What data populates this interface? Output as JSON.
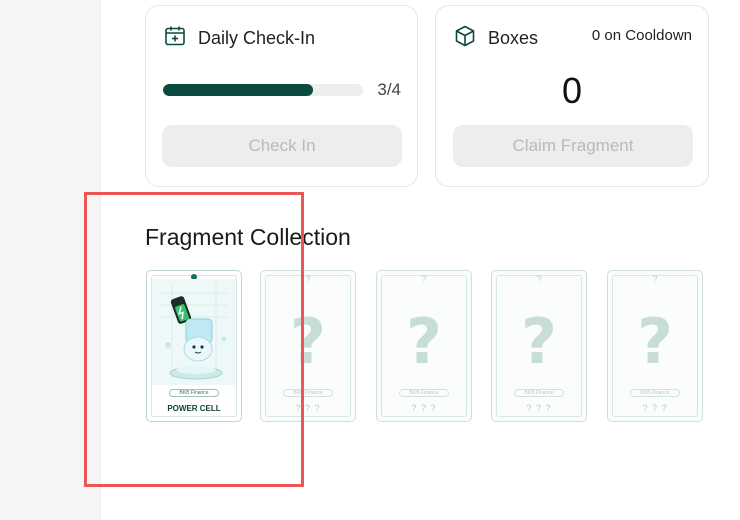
{
  "checkin": {
    "title": "Daily Check-In",
    "progress_text": "3/4",
    "progress_fraction": 0.75,
    "button_label": "Check In"
  },
  "boxes": {
    "title": "Boxes",
    "cooldown_text": "0 on Cooldown",
    "count": "0",
    "button_label": "Claim Fragment"
  },
  "collection": {
    "title": "Fragment Collection",
    "fragments": [
      {
        "name": "POWER CELL",
        "brand": "BKB Finance",
        "unlocked": true
      },
      {
        "top": "?",
        "mark": "?",
        "brand": "BKB Finance",
        "name": "? ? ?",
        "unlocked": false
      },
      {
        "top": "?",
        "mark": "?",
        "brand": "BKB Finance",
        "name": "? ? ?",
        "unlocked": false
      },
      {
        "top": "?",
        "mark": "?",
        "brand": "BKB Finance",
        "name": "? ? ?",
        "unlocked": false
      },
      {
        "top": "?",
        "mark": "?",
        "brand": "BKB Finance",
        "name": "? ? ?",
        "unlocked": false
      }
    ]
  },
  "icons": {
    "checkin": "calendar-plus-icon",
    "boxes": "cube-icon"
  },
  "colors": {
    "accent": "#0b4a3e",
    "highlight": "#ee5555"
  }
}
